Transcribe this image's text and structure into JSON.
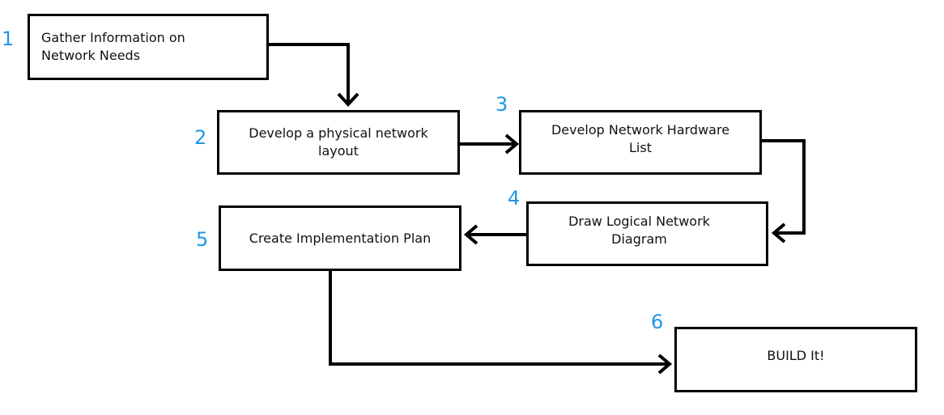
{
  "colors": {
    "step_number": "#1f96e6",
    "line": "#000000"
  },
  "steps": [
    {
      "number": "1",
      "line1": "Gather Information on",
      "line2": "Network Needs"
    },
    {
      "number": "2",
      "line1": "Develop a physical network",
      "line2": "layout"
    },
    {
      "number": "3",
      "line1": "Develop Network Hardware",
      "line2": "List"
    },
    {
      "number": "4",
      "line1": "Draw Logical Network",
      "line2": "Diagram"
    },
    {
      "number": "5",
      "line1": "Create Implementation Plan",
      "line2": ""
    },
    {
      "number": "6",
      "line1": "BUILD It!",
      "line2": ""
    }
  ]
}
